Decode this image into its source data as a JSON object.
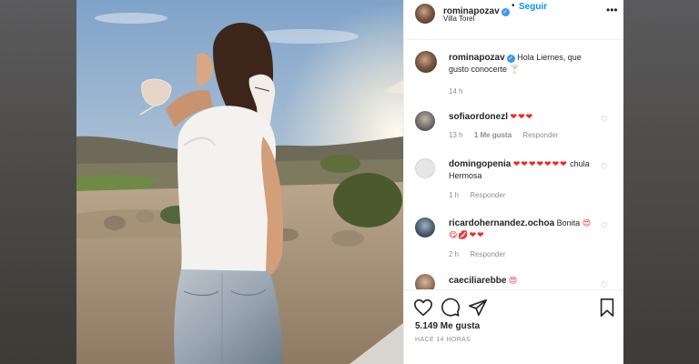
{
  "post": {
    "username": "rominapozav",
    "location": "Villa Torel",
    "follow_label": "Seguir",
    "dot": "•",
    "more": "•••"
  },
  "caption": {
    "username": "rominapozav",
    "text": "Hola Liernes, que gusto conocerte",
    "emoji": "🍸",
    "time": "14 h"
  },
  "comments": [
    {
      "username": "sofiaordonezl",
      "text": "",
      "hearts": "❤❤❤",
      "time": "13 h",
      "likes": "1 Me gusta",
      "reply": "Responder"
    },
    {
      "username": "domingopenia",
      "text": "chula Hermosa",
      "hearts": "❤❤❤❤❤❤❤",
      "time": "1 h",
      "likes": "",
      "reply": "Responder"
    },
    {
      "username": "ricardohernandez.ochoa",
      "text": "Bonita",
      "hearts": "😍😋💋❤❤",
      "time": "2 h",
      "likes": "",
      "reply": "Responder"
    },
    {
      "username": "caeciliarebbe",
      "text": "",
      "hearts": "😍",
      "time": "",
      "likes": "",
      "reply": ""
    }
  ],
  "footer": {
    "likes": "5.149 Me gusta",
    "time_ago": "HACE 14 HORAS"
  },
  "icons": {
    "verified": "✓",
    "heart_outline": "♡"
  },
  "colors": {
    "accent": "#0095f6",
    "verified": "#3897f0",
    "text": "#262626",
    "muted": "#8e8e8e",
    "heart": "#ed2a2a"
  }
}
